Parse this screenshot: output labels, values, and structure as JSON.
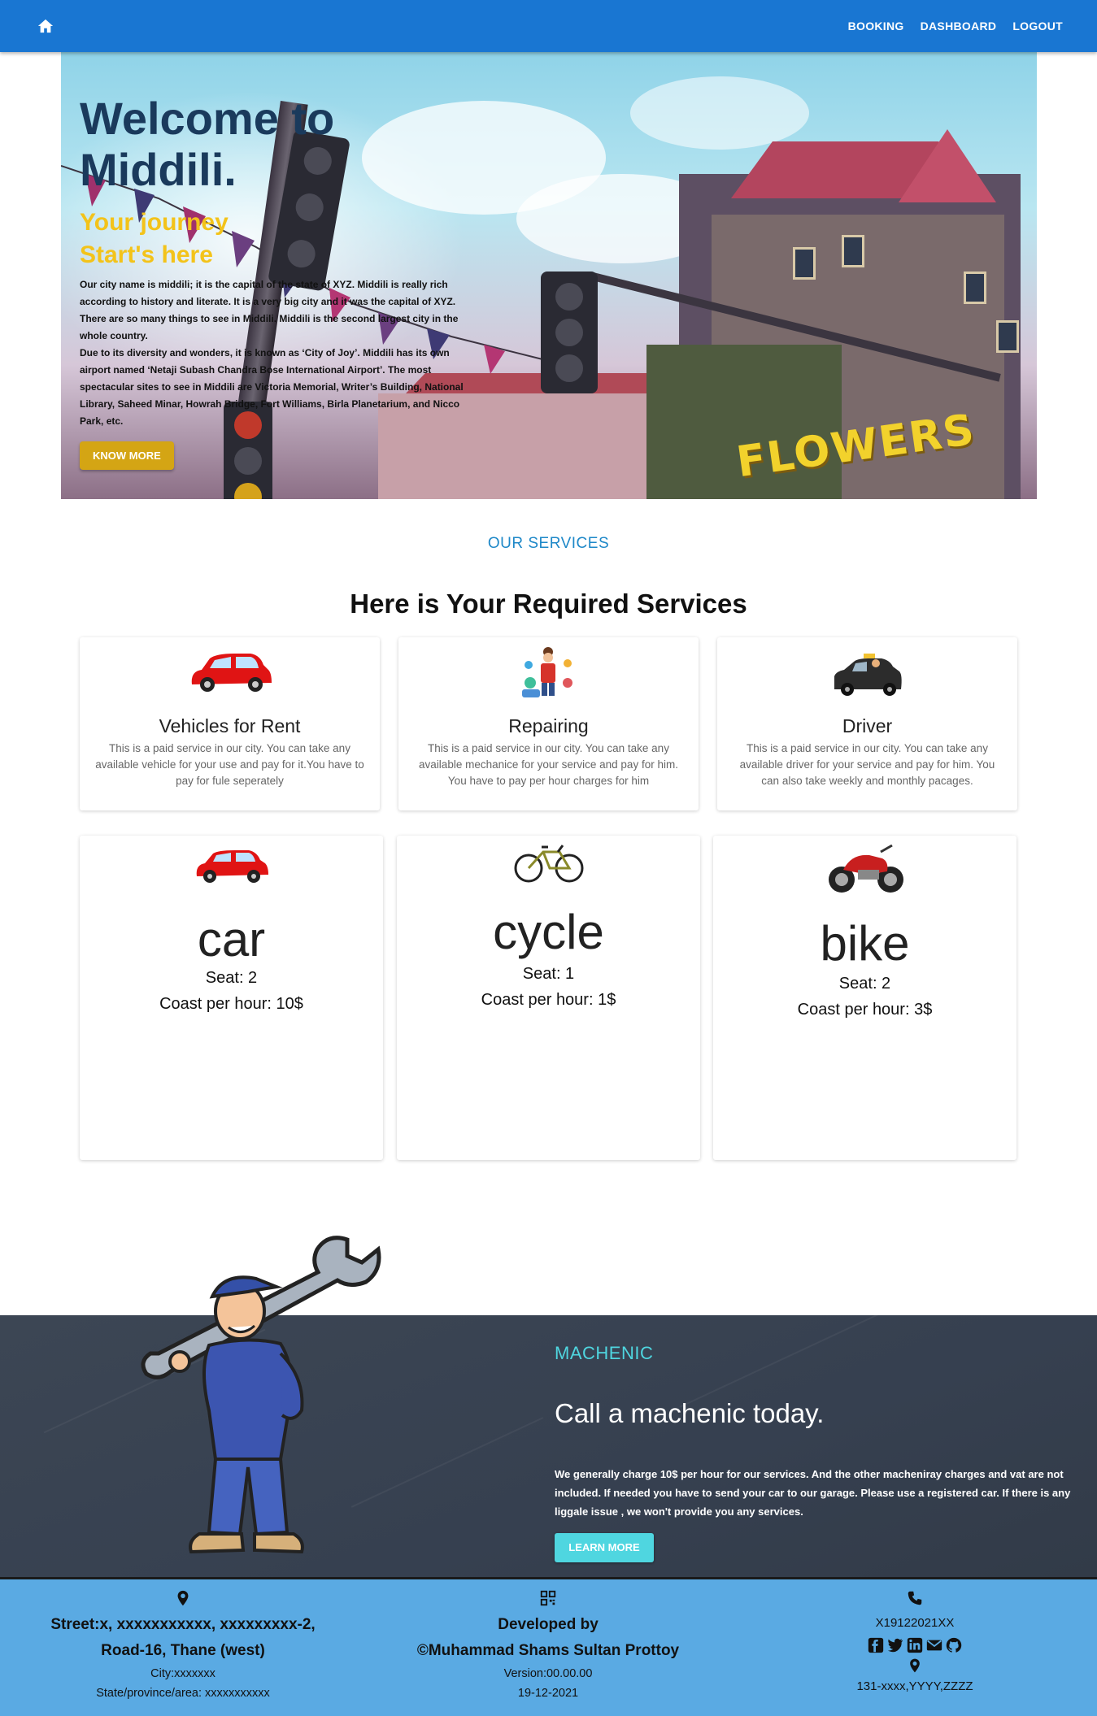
{
  "navbar": {
    "home_icon": "home-icon",
    "links": [
      "BOOKING",
      "DASHBOARD",
      "LOGOUT"
    ]
  },
  "hero": {
    "title": "Welcome to Middili.",
    "subtitle_line1": "Your journey",
    "subtitle_line2": "Start's here",
    "paragraph1": "Our city name is middili; it is the capital of the state of XYZ. Middili is really rich according to history and literate. It is a very big city and it was the capital of XYZ. There are so many things to see in Middili. Middili is the second largest city in the whole country.",
    "paragraph2": "Due to its diversity and wonders, it is known as ‘City of Joy’. Middili has its own airport named ‘Netaji Subash Chandra Bose International Airport’. The most spectacular sites to see in Middili are Victoria Memorial, Writer’s Building, National Library, Saheed Minar, Howrah Bridge, Fort Williams, Birla Planetarium, and Nicco Park, etc.",
    "button": "KNOW MORE",
    "sign_text": "FLOWERS"
  },
  "services": {
    "label": "OUR SERVICES",
    "title": "Here is Your Required Services",
    "cards": [
      {
        "title": "Vehicles for Rent",
        "desc": "This is a paid service in our city. You can take any available vehicle for your use and pay for it.You have to pay for fule seperately"
      },
      {
        "title": "Repairing",
        "desc": "This is a paid service in our city. You can take any available mechanice for your service and pay for him. You have to pay per hour charges for him"
      },
      {
        "title": "Driver",
        "desc": "This is a paid service in our city. You can take any available driver for your service and pay for him. You can also take weekly and monthly pacages."
      }
    ]
  },
  "vehicles": [
    {
      "name": "car",
      "seat": "Seat: 2",
      "cost": "Coast per hour: 10$"
    },
    {
      "name": "cycle",
      "seat": "Seat: 1",
      "cost": "Coast per hour: 1$"
    },
    {
      "name": "bike",
      "seat": "Seat: 2",
      "cost": "Coast per hour: 3$"
    }
  ],
  "mechanic": {
    "label": "MACHENIC",
    "title": "Call a machenic today.",
    "body": "We generally charge 10$ per hour for our services. And the other macheniray charges and vat are not included. If needed you have to send your car to our garage. Please use a registered car. If there is any liggale issue , we won't provide you any services.",
    "button": "LEARN MORE"
  },
  "footer": {
    "address_line1": "Street:x, xxxxxxxxxxx, xxxxxxxxx-2,",
    "address_line2": "Road-16, Thane (west)",
    "city": "City:xxxxxxx",
    "state": "State/province/area: xxxxxxxxxxx",
    "developed_by": "Developed by",
    "developer": "©Muhammad Shams Sultan Prottoy",
    "version": "Version:00.00.00",
    "date": "19-12-2021",
    "phone": "X19122021XX",
    "location": "131-xxxx,YYYY,ZZZZ",
    "social_icons": [
      "facebook-icon",
      "twitter-icon",
      "linkedin-icon",
      "email-icon",
      "github-icon"
    ]
  },
  "colors": {
    "nav": "#1976d2",
    "hero_button": "#d4a514",
    "services_label": "#1e88c8",
    "mechanic_accent": "#4fd6e0",
    "footer": "#5aaae3"
  }
}
